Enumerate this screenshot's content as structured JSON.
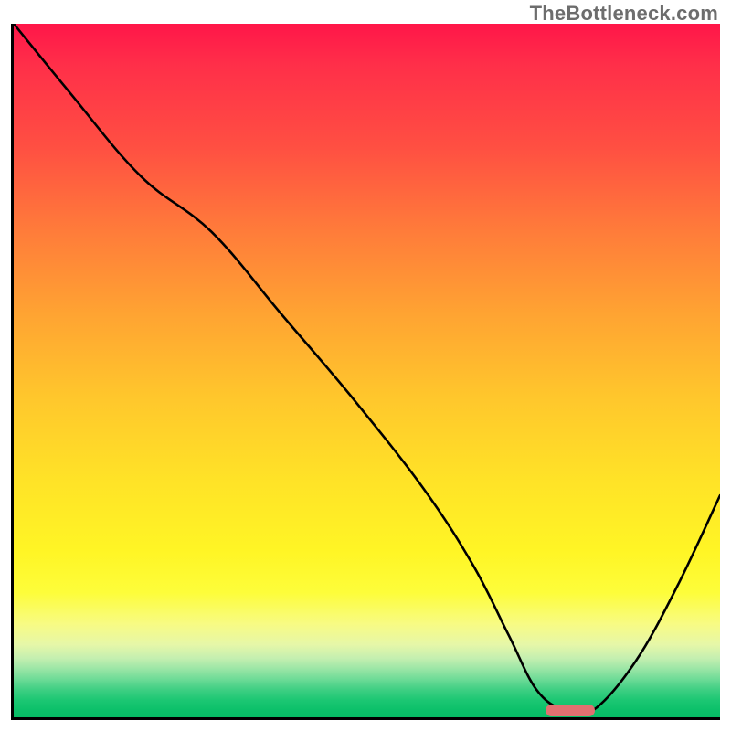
{
  "watermark": "TheBottleneck.com",
  "chart_data": {
    "type": "line",
    "title": "",
    "xlabel": "",
    "ylabel": "",
    "xlim": [
      0,
      100
    ],
    "ylim": [
      0,
      100
    ],
    "grid": false,
    "legend": false,
    "background_gradient": {
      "direction": "vertical",
      "stops": [
        {
          "pos": 0.0,
          "color": "#ff1649"
        },
        {
          "pos": 0.5,
          "color": "#ffc72c"
        },
        {
          "pos": 0.8,
          "color": "#fdfd3a"
        },
        {
          "pos": 1.0,
          "color": "#06bd65"
        }
      ]
    },
    "series": [
      {
        "name": "bottleneck-curve",
        "x": [
          0,
          8,
          18,
          28,
          38,
          48,
          58,
          65,
          70,
          74,
          78,
          82,
          88,
          94,
          100
        ],
        "y": [
          100,
          90,
          78,
          70,
          58,
          46,
          33,
          22,
          12,
          4,
          1,
          1,
          8,
          19,
          32
        ]
      }
    ],
    "marker": {
      "name": "optimal-range",
      "x_start": 75,
      "x_end": 82,
      "y": 1.5,
      "color": "#e17070"
    }
  }
}
